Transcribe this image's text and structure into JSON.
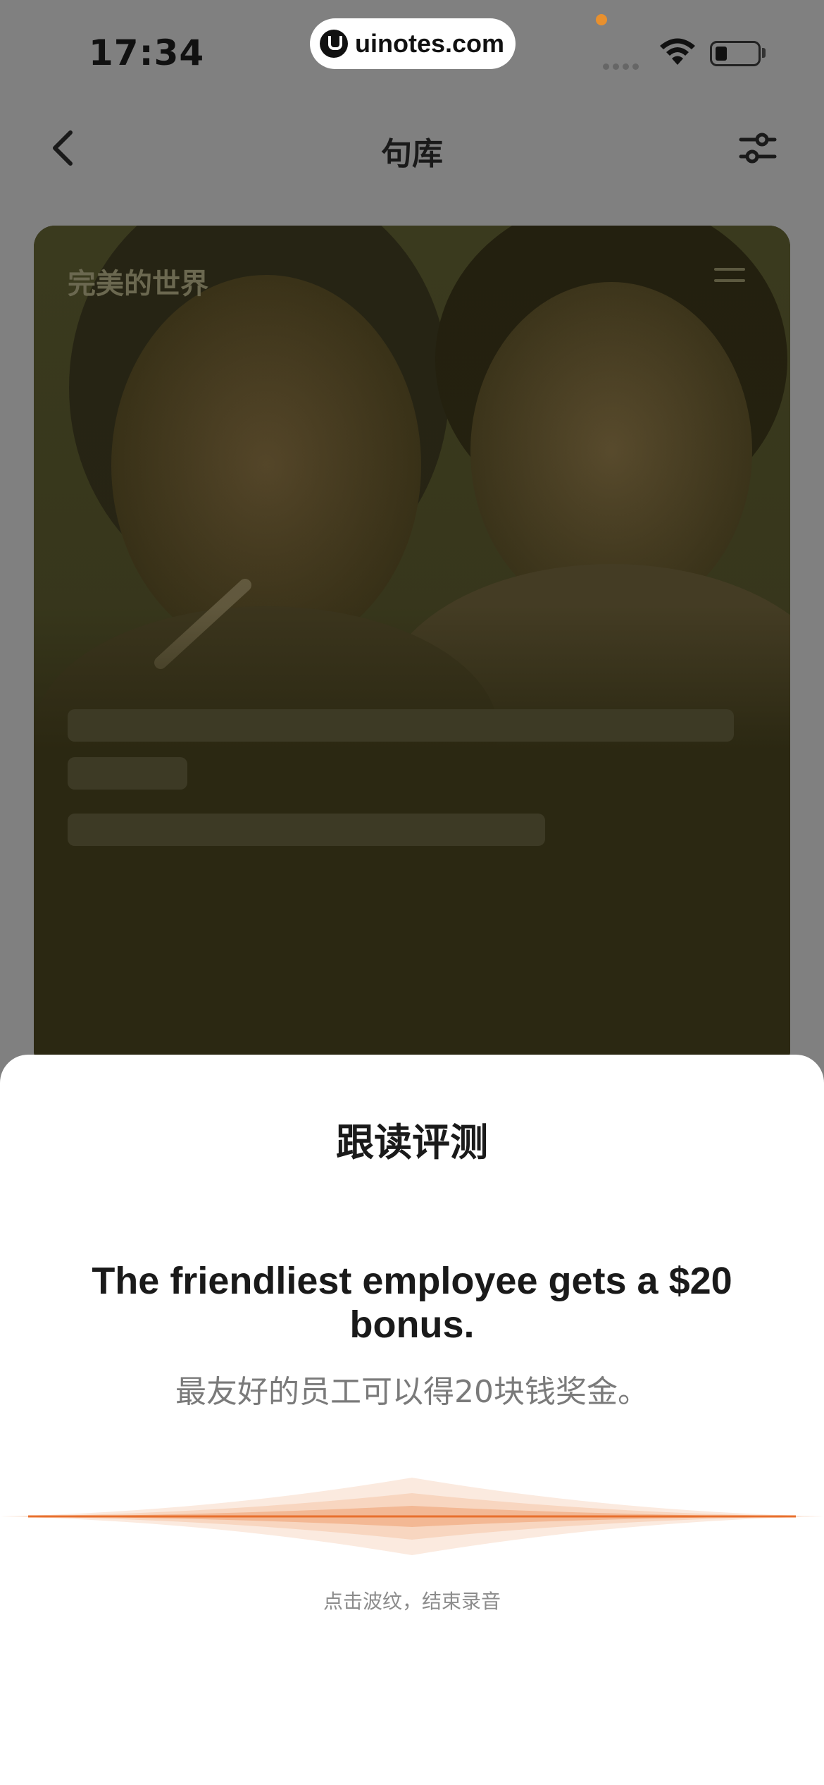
{
  "status_bar": {
    "time": "17:34",
    "url": "uinotes.com",
    "icons": [
      "wifi-icon",
      "battery-icon"
    ]
  },
  "nav": {
    "title": "句库",
    "back_icon": "chevron-left-icon",
    "filter_icon": "sliders-icon"
  },
  "card": {
    "title": "完美的世界",
    "menu_icon": "menu-icon"
  },
  "sheet": {
    "title": "跟读评测",
    "sentence_en": "The friendliest employee gets a $20 bonus.",
    "sentence_cn": "最友好的员工可以得20块钱奖金。",
    "hint": "点击波纹，结束录音"
  },
  "colors": {
    "accent": "#e8702e",
    "wave_light": "#fbe4d6",
    "overlay": "#808080"
  }
}
